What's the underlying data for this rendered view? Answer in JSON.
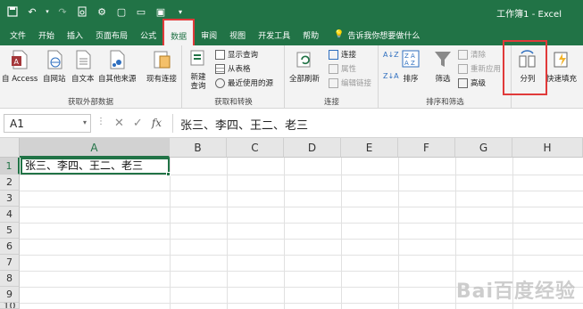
{
  "window": {
    "title": "工作簿1 - Excel"
  },
  "tabs": [
    {
      "label": "文件"
    },
    {
      "label": "开始"
    },
    {
      "label": "插入"
    },
    {
      "label": "页面布局"
    },
    {
      "label": "公式"
    },
    {
      "label": "数据",
      "active": true
    },
    {
      "label": "审阅"
    },
    {
      "label": "视图"
    },
    {
      "label": "开发工具"
    },
    {
      "label": "帮助"
    }
  ],
  "tellme": {
    "label": "告诉我你想要做什么",
    "icon": "lightbulb-icon"
  },
  "ribbon": {
    "get_external": {
      "group_label": "获取外部数据",
      "buttons": [
        {
          "label": "自 Access",
          "icon": "access-icon"
        },
        {
          "label": "自网站",
          "icon": "web-icon"
        },
        {
          "label": "自文本",
          "icon": "text-file-icon"
        },
        {
          "label": "自其他来源",
          "icon": "other-sources-icon"
        },
        {
          "label": "现有连接",
          "icon": "existing-connections-icon"
        }
      ]
    },
    "get_transform": {
      "group_label": "获取和转换",
      "new_query": "新建\n查询",
      "items": [
        {
          "label": "显示查询",
          "icon": "show-queries-icon"
        },
        {
          "label": "从表格",
          "icon": "from-table-icon"
        },
        {
          "label": "最近使用的源",
          "icon": "recent-sources-icon"
        }
      ]
    },
    "connections": {
      "group_label": "连接",
      "refresh_all": "全部刷新",
      "items": [
        {
          "label": "连接",
          "icon": "connections-icon",
          "disabled": false
        },
        {
          "label": "属性",
          "icon": "properties-icon",
          "disabled": true
        },
        {
          "label": "编辑链接",
          "icon": "edit-links-icon",
          "disabled": true
        }
      ]
    },
    "sort_filter": {
      "group_label": "排序和筛选",
      "sort_az": "A↓Z",
      "sort_za": "Z↓A",
      "sort": "排序",
      "filter": "筛选",
      "items": [
        {
          "label": "清除",
          "icon": "clear-filter-icon",
          "disabled": true
        },
        {
          "label": "重新应用",
          "icon": "reapply-icon",
          "disabled": true
        },
        {
          "label": "高级",
          "icon": "advanced-filter-icon",
          "disabled": false
        }
      ]
    },
    "data_tools": {
      "text_to_columns": "分列",
      "flash_fill": "快速填充"
    }
  },
  "formula_bar": {
    "name_box": "A1",
    "fx": "fx",
    "content": "张三、李四、王二、老三"
  },
  "grid": {
    "columns": [
      "A",
      "B",
      "C",
      "D",
      "E",
      "F",
      "G",
      "H"
    ],
    "rows": [
      "1",
      "2",
      "3",
      "4",
      "5",
      "6",
      "7",
      "8",
      "9",
      "10"
    ],
    "cells": {
      "A1": "张三、李四、王二、老三"
    }
  },
  "watermark": "Bai百度经验",
  "colors": {
    "excel_green": "#217346",
    "highlight_red": "#e03a3a"
  }
}
